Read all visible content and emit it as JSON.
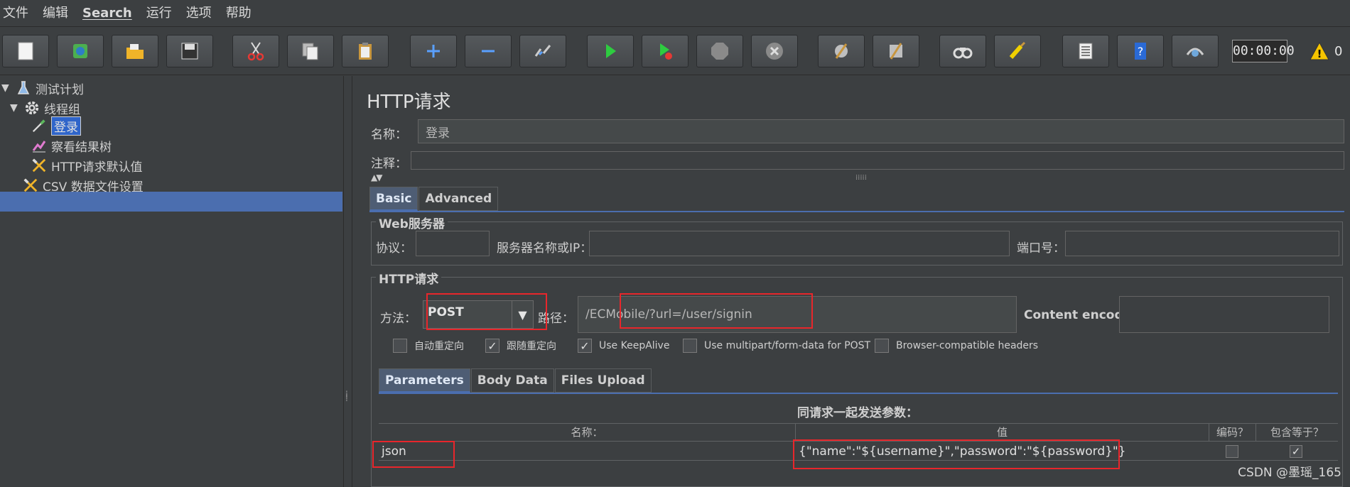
{
  "menu": [
    "文件",
    "编辑",
    "Search",
    "运行",
    "选项",
    "帮助"
  ],
  "toolbar": {
    "buttons": [
      "new-icon",
      "templates-icon",
      "open-icon",
      "save-icon",
      "cut-icon",
      "copy-icon",
      "paste-icon",
      "expand-icon",
      "collapse-icon",
      "toggle-icon",
      "start-icon",
      "start-no-pause-icon",
      "stop-icon",
      "shutdown-icon",
      "clear-icon",
      "clear-all-icon",
      "search-icon",
      "reset-search-icon",
      "function-helper-icon",
      "help-icon",
      "remote-icon"
    ],
    "timer": "00:00:00",
    "warning_count": "0"
  },
  "tree": {
    "items": [
      {
        "label": "测试计划",
        "expanded": true
      },
      {
        "label": "线程组",
        "expanded": true
      },
      {
        "label": "登录",
        "selected": true
      },
      {
        "label": "察看结果树"
      },
      {
        "label": "HTTP请求默认值"
      },
      {
        "label": "CSV 数据文件设置"
      }
    ]
  },
  "panel": {
    "title": "HTTP请求",
    "name_label": "名称：",
    "name_value": "登录",
    "comment_label": "注释：",
    "comment_value": ""
  },
  "tabs": {
    "basic": "Basic",
    "advanced": "Advanced"
  },
  "web_server": {
    "title": "Web服务器",
    "protocol_label": "协议：",
    "protocol_value": "",
    "server_label": "服务器名称或IP：",
    "server_value": "",
    "port_label": "端口号：",
    "port_value": ""
  },
  "http_request": {
    "title": "HTTP请求",
    "method_label": "方法：",
    "method_value": "POST",
    "path_label": "路径：",
    "path_value": "/ECMobile/?url=/user/signin",
    "encoding_label": "Content encoding:",
    "encoding_value": ""
  },
  "options": [
    {
      "label": "自动重定向",
      "checked": false
    },
    {
      "label": "跟随重定向",
      "checked": true
    },
    {
      "label": "Use KeepAlive",
      "checked": true
    },
    {
      "label": "Use multipart/form-data for POST",
      "checked": false
    },
    {
      "label": "Browser-compatible headers",
      "checked": false
    }
  ],
  "subtabs": {
    "parameters": "Parameters",
    "body_data": "Body Data",
    "files_upload": "Files Upload"
  },
  "params": {
    "caption": "同请求一起发送参数：",
    "columns": [
      "名称：",
      "值",
      "编码？",
      "包含等于？"
    ],
    "rows": [
      {
        "name": "json",
        "value": "{\"name\":\"${username}\",\"password\":\"${password}\"}",
        "encode": false,
        "include_equals": true
      }
    ]
  },
  "watermark": "CSDN @墨瑶_165"
}
